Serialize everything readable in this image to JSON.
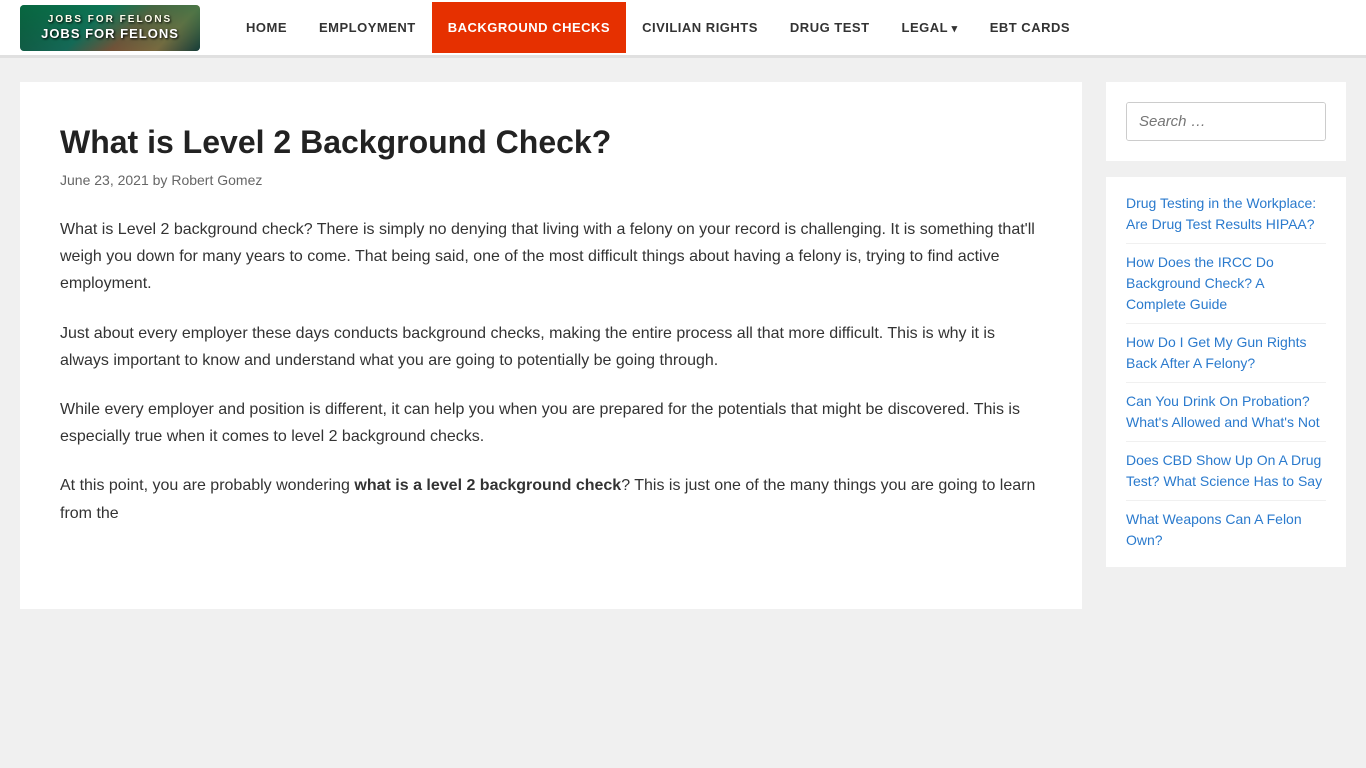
{
  "nav": {
    "logo_text": "JOBS FOR FELONS",
    "logo_sub": "JOBS FOR FELONS",
    "items": [
      {
        "label": "HOME",
        "href": "#",
        "active": false
      },
      {
        "label": "EMPLOYMENT",
        "href": "#",
        "active": false
      },
      {
        "label": "BACKGROUND CHECKS",
        "href": "#",
        "active": true
      },
      {
        "label": "CIVILIAN RIGHTS",
        "href": "#",
        "active": false
      },
      {
        "label": "DRUG TEST",
        "href": "#",
        "active": false
      },
      {
        "label": "LEGAL",
        "href": "#",
        "active": false,
        "has_arrow": true
      },
      {
        "label": "EBT CARDS",
        "href": "#",
        "active": false
      }
    ]
  },
  "article": {
    "title": "What is Level 2 Background Check?",
    "date": "June 23, 2021",
    "author": "Robert Gomez",
    "paragraphs": [
      "What is Level 2 background check? There is simply no denying that living with a felony on your record is challenging. It is something that'll weigh you down for many years to come. That being said, one of the most difficult things about having a felony is, trying to find active employment.",
      "Just about every employer these days conducts background checks, making the entire process all that more difficult. This is why it is always important to know and understand what you are going to potentially be going through.",
      "While every employer and position is different, it can help you when you are prepared for the potentials that might be discovered. This is especially true when it comes to level 2 background checks.",
      "At this point, you are probably wondering what is a level 2 background check? This is just one of the many things you are going to learn from the"
    ],
    "paragraph_bold_start": "what is a level 2 background check"
  },
  "sidebar": {
    "search_placeholder": "Search …",
    "links": [
      {
        "label": "Drug Testing in the Workplace: Are Drug Test Results HIPAA?",
        "href": "#"
      },
      {
        "label": "How Does the IRCC Do Background Check? A Complete Guide",
        "href": "#"
      },
      {
        "label": "How Do I Get My Gun Rights Back After A Felony?",
        "href": "#"
      },
      {
        "label": "Can You Drink On Probation? What's Allowed and What's Not",
        "href": "#"
      },
      {
        "label": "Does CBD Show Up On A Drug Test? What Science Has to Say",
        "href": "#"
      },
      {
        "label": "What Weapons Can A Felon Own?",
        "href": "#"
      }
    ]
  }
}
